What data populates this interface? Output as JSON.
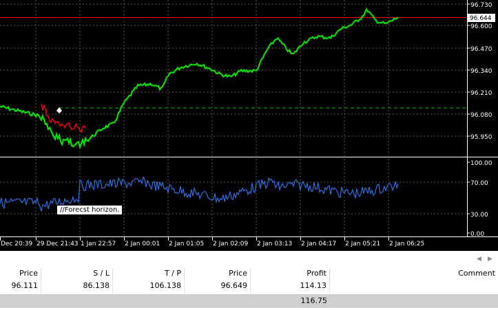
{
  "chart": {
    "price_axis_labels": [
      "96.730",
      "96.600",
      "96.470",
      "96.340",
      "96.210",
      "96.080",
      "95.950"
    ],
    "current_price_label": "96.644",
    "indicator_axis_labels": [
      "100.00",
      "70.00",
      "30.00",
      "0.00"
    ],
    "time_axis_labels": [
      "Dec 20:39",
      "29 Dec 21:43",
      "1 Jan 22:57",
      "2 Jan 00:01",
      "2 Jan 01:05",
      "2 Jan 02:09",
      "2 Jan 03:13",
      "2 Jan 04:17",
      "2 Jan 05:21",
      "2 Jan 06:25"
    ],
    "tooltip_text": "//Forecst horizon.",
    "colors": {
      "background": "#000000",
      "price_up": "#00e000",
      "price_down": "#ff0000",
      "forecast_line": "#00c000",
      "current_price_line": "#ff0000",
      "indicator_line": "#2f6fe0",
      "grid": "#5a5a5a",
      "axis_text": "#ffffff"
    }
  },
  "scroll": {
    "left_arrow": "◀",
    "right_arrow": "▶"
  },
  "table": {
    "headers": [
      "Price",
      "S / L",
      "T / P",
      "Price",
      "Profit",
      "Comment"
    ],
    "row": [
      "96.111",
      "86.138",
      "106.138",
      "96.649",
      "114.13",
      ""
    ],
    "total_profit": "116.75"
  }
}
